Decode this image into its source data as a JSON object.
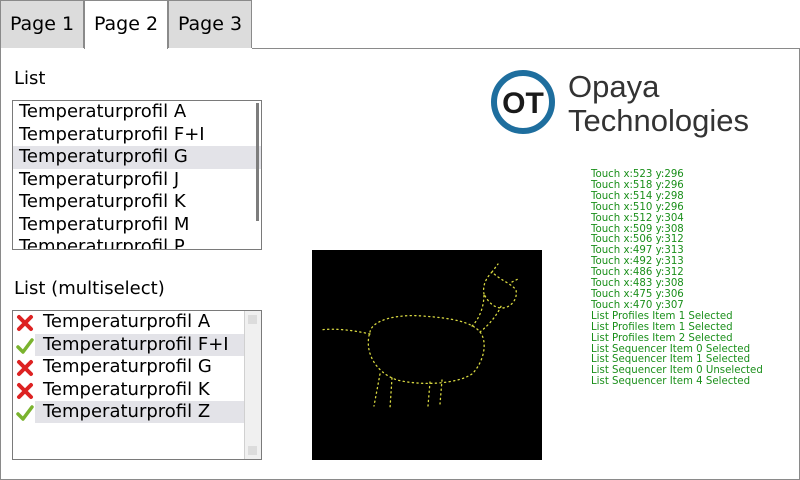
{
  "tabs": [
    {
      "label": "Page 1",
      "active": false
    },
    {
      "label": "Page 2",
      "active": true
    },
    {
      "label": "Page 3",
      "active": false
    }
  ],
  "list": {
    "label": "List",
    "items": [
      {
        "label": "Temperaturprofil A",
        "selected": false
      },
      {
        "label": "Temperaturprofil F+I",
        "selected": false
      },
      {
        "label": "Temperaturprofil G",
        "selected": true
      },
      {
        "label": "Temperaturprofil J",
        "selected": false
      },
      {
        "label": "Temperaturprofil K",
        "selected": false
      },
      {
        "label": "Temperaturprofil M",
        "selected": false
      },
      {
        "label": "Temperaturprofil P",
        "selected": false
      }
    ]
  },
  "multiselect": {
    "label": "List (multiselect)",
    "items": [
      {
        "label": "Temperaturprofil A",
        "checked": false,
        "icon": "x-mark-icon"
      },
      {
        "label": "Temperaturprofil F+I",
        "checked": true,
        "icon": "check-mark-icon"
      },
      {
        "label": "Temperaturprofil G",
        "checked": false,
        "icon": "x-mark-icon"
      },
      {
        "label": "Temperaturprofil K",
        "checked": false,
        "icon": "x-mark-icon"
      },
      {
        "label": "Temperaturprofil Z",
        "checked": true,
        "icon": "check-mark-icon"
      }
    ]
  },
  "logo": {
    "initials": "OT",
    "line1": "Opaya",
    "line2": "Technologies",
    "color": "#1e6e9e"
  },
  "log": [
    "Touch x:523 y:296",
    "Touch x:518 y:296",
    "Touch x:514 y:298",
    "Touch x:510 y:296",
    "Touch x:512 y:304",
    "Touch x:509 y:308",
    "Touch x:506 y:312",
    "Touch x:497 y:313",
    "Touch x:492 y:313",
    "Touch x:486 y:312",
    "Touch x:483 y:308",
    "Touch x:475 y:306",
    "Touch x:470 y:307",
    "List Profiles Item 1 Selected",
    "List Profiles Item 1 Selected",
    "List Profiles Item 2 Selected",
    "List Sequencer Item 0 Selected",
    "List Sequencer Item 1 Selected",
    "List Sequencer Item 0 Unselected",
    "List Sequencer Item 4 Selected"
  ],
  "colors": {
    "log_text": "#1a8f1a",
    "drawing_dots": "#d8d840",
    "canvas_bg": "#000000"
  }
}
